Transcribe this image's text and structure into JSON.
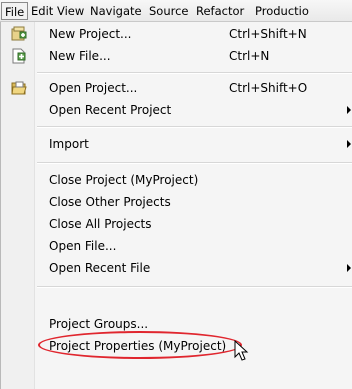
{
  "menubar": {
    "items": [
      "File",
      "Edit",
      "View",
      "Navigate",
      "Source",
      "Refactor",
      "Productio"
    ]
  },
  "menu": {
    "new_project": {
      "label": "New Project...",
      "shortcut": "Ctrl+Shift+N",
      "icon": "new-project-icon"
    },
    "new_file": {
      "label": "New File...",
      "shortcut": "Ctrl+N",
      "icon": "new-file-icon"
    },
    "open_project": {
      "label": "Open Project...",
      "shortcut": "Ctrl+Shift+O",
      "icon": "open-project-icon"
    },
    "open_recent_project": {
      "label": "Open Recent Project",
      "submenu": true
    },
    "import": {
      "label": "Import",
      "submenu": true
    },
    "close_project": {
      "label": "Close Project (MyProject)"
    },
    "close_other_projects": {
      "label": "Close Other Projects"
    },
    "close_all_projects": {
      "label": "Close All Projects"
    },
    "open_file": {
      "label": "Open File..."
    },
    "open_recent_file": {
      "label": "Open Recent File",
      "submenu": true
    },
    "project_groups": {
      "label": "Project Groups..."
    },
    "project_properties": {
      "label": "Project Properties (MyProject)"
    }
  },
  "colors": {
    "highlight_ring": "#e0262e"
  }
}
